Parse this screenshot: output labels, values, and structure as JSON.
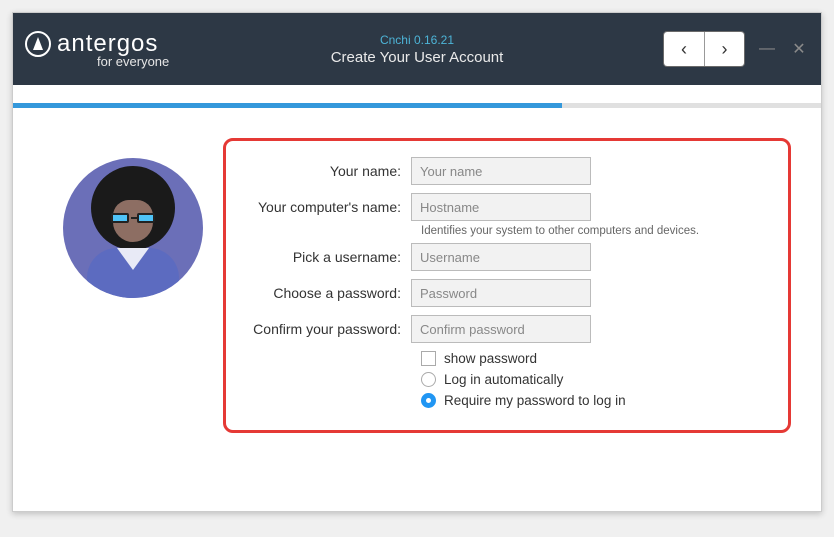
{
  "brand": {
    "name": "antergos",
    "tagline": "for everyone"
  },
  "header": {
    "version": "Cnchi  0.16.21",
    "step_title": "Create Your User Account"
  },
  "progress": {
    "percent": 68
  },
  "form": {
    "name_label": "Your name:",
    "name_placeholder": "Your name",
    "hostname_label": "Your computer's name:",
    "hostname_placeholder": "Hostname",
    "hostname_help": "Identifies your system to other computers and devices.",
    "username_label": "Pick a username:",
    "username_placeholder": "Username",
    "password_label": "Choose a password:",
    "password_placeholder": "Password",
    "confirm_label": "Confirm your password:",
    "confirm_placeholder": "Confirm password",
    "show_password_label": "show password",
    "autologin_label": "Log in automatically",
    "require_password_label": "Require my password to log in"
  }
}
